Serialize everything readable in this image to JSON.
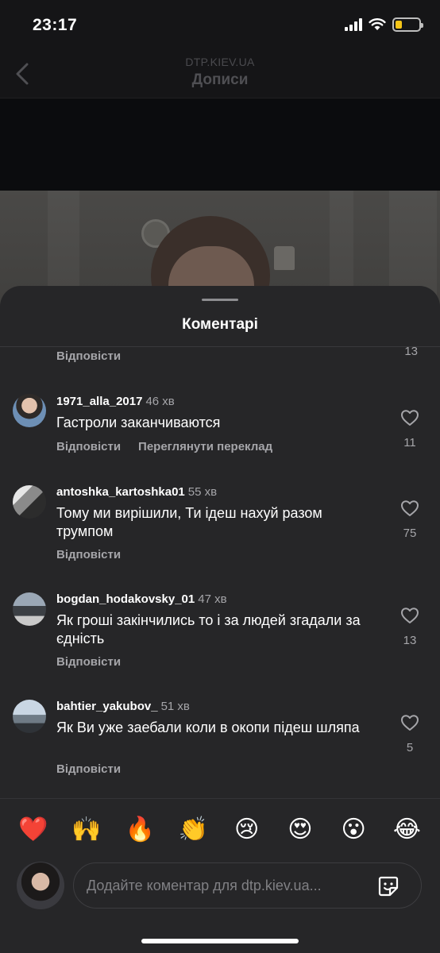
{
  "status_bar": {
    "time": "23:17",
    "battery_level": 0.28,
    "battery_color": "#f5c518"
  },
  "header": {
    "subtitle": "DTP.KIEV.UA",
    "title": "Дописи"
  },
  "sheet": {
    "title": "Коментарі"
  },
  "previous_comment": {
    "reply_label": "Відповісти",
    "likes": "13"
  },
  "comments": [
    {
      "username": "1971_alla_2017",
      "time": "46 хв",
      "text": "Гастроли заканчиваются",
      "reply_label": "Відповісти",
      "translate_label": "Переглянути переклад",
      "likes": "11"
    },
    {
      "username": "antoshka_kartoshka01",
      "time": "55 хв",
      "text": "Тому ми вирішили, Ти ідеш нахуй разом трумпом",
      "reply_label": "Відповісти",
      "likes": "75"
    },
    {
      "username": "bogdan_hodakovsky_01",
      "time": "47 хв",
      "text": "Як гроші закінчились то і за людей згадали за єдність",
      "reply_label": "Відповісти",
      "likes": "13"
    },
    {
      "username": "bahtier_yakubov_",
      "time": "51 хв",
      "text": "Як Ви уже заебали коли в окопи підеш шляпа",
      "reply_label": "Відповісти",
      "likes": "5"
    }
  ],
  "emoji_reactions": [
    "❤️",
    "🙌",
    "🔥",
    "👏",
    "😢",
    "😍",
    "😮",
    "😂"
  ],
  "composer": {
    "placeholder": "Додайте коментар для dtp.kiev.ua..."
  },
  "icons": {
    "back": "chevron-left-icon",
    "like": "heart-outline-icon",
    "sticker": "sticker-icon"
  }
}
